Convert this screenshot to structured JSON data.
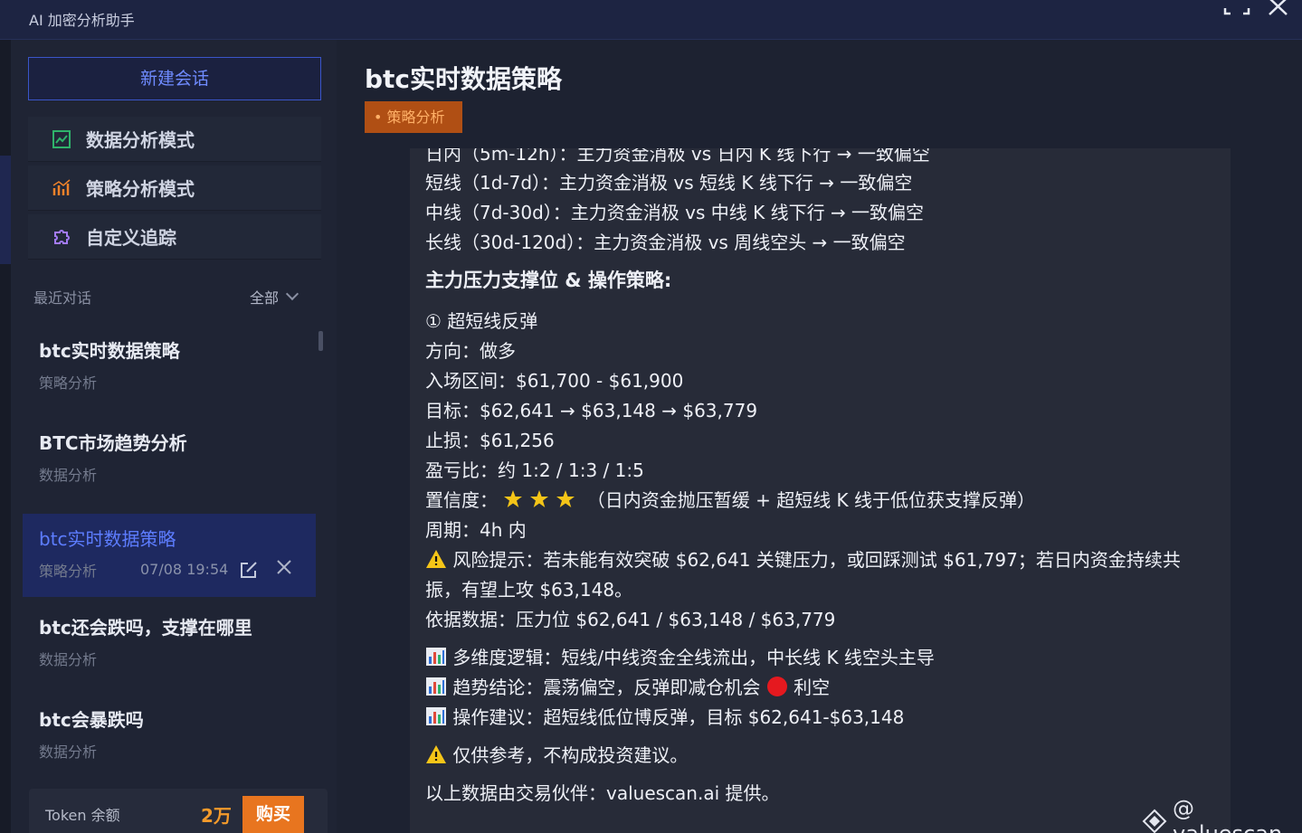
{
  "app": {
    "title": "AI 加密分析助手"
  },
  "sidebar": {
    "new_chat_label": "新建会话",
    "modes": [
      {
        "label": "数据分析模式",
        "icon": "chart-icon"
      },
      {
        "label": "策略分析模式",
        "icon": "strategy-icon"
      },
      {
        "label": "自定义追踪",
        "icon": "puzzle-icon"
      }
    ],
    "recent_label": "最近对话",
    "filter_label": "全部",
    "conversations": [
      {
        "title": "btc实时数据策略",
        "subtitle": "策略分析"
      },
      {
        "title": "BTC市场趋势分析",
        "subtitle": "数据分析"
      },
      {
        "title": "btc实时数据策略",
        "subtitle": "策略分析",
        "time": "07/08 19:54",
        "active": true
      },
      {
        "title": "btc还会跌吗，支撑在哪里",
        "subtitle": "数据分析"
      },
      {
        "title": "btc会暴跌吗",
        "subtitle": "数据分析"
      }
    ],
    "token": {
      "label": "Token 余额",
      "count": "2万",
      "buy_label": "购买"
    }
  },
  "main": {
    "title": "btc实时数据策略",
    "tag": "• 策略分析",
    "lines": {
      "l0": "日内（5m-12h）：主力资金消极 vs 日内 K 线下行 → 一致偏空",
      "l1": "短线（1d-7d）：主力资金消极 vs 短线 K 线下行 → 一致偏空",
      "l2": "中线（7d-30d）：主力资金消极 vs 中线 K 线下行 → 一致偏空",
      "l3": "长线（30d-120d）：主力资金消极 vs 周线空头 → 一致偏空",
      "h1": "主力压力支撑位 & 操作策略:",
      "l4": "① 超短线反弹",
      "l5": "方向：做多",
      "l6": "入场区间：$61,700 - $61,900",
      "l7": "目标：$62,641 → $63,148 → $63,779",
      "l8": "止损：$61,256",
      "l9": "盈亏比：约 1:2 / 1:3 / 1:5",
      "l10a": "置信度：",
      "l10b": "（日内资金抛压暂缓 + 超短线 K 线于低位获支撑反弹）",
      "l11": "周期：4h 内",
      "l12": "风险提示：若未能有效突破 $62,641 关键压力，或回踩测试 $61,797；若日内资金持续共",
      "l13": "振，有望上攻 $63,148。",
      "l14": "依据数据：压力位 $62,641 / $63,148 / $63,779",
      "l15": "多维度逻辑：短线/中线资金全线流出，中长线 K 线空头主导",
      "l16a": "趋势结论：震荡偏空，反弹即减仓机会",
      "l16b": "利空",
      "l17": "操作建议：超短线低位博反弹，目标 $62,641-$63,148",
      "l18": "仅供参考，不构成投资建议。",
      "l19": "以上数据由交易伙伴：valuescan.ai 提供。"
    }
  },
  "watermark": "@ valuescan",
  "colors": {
    "accent": "#5d7dff",
    "orange": "#e8751f",
    "tag_bg": "#b04f14"
  }
}
